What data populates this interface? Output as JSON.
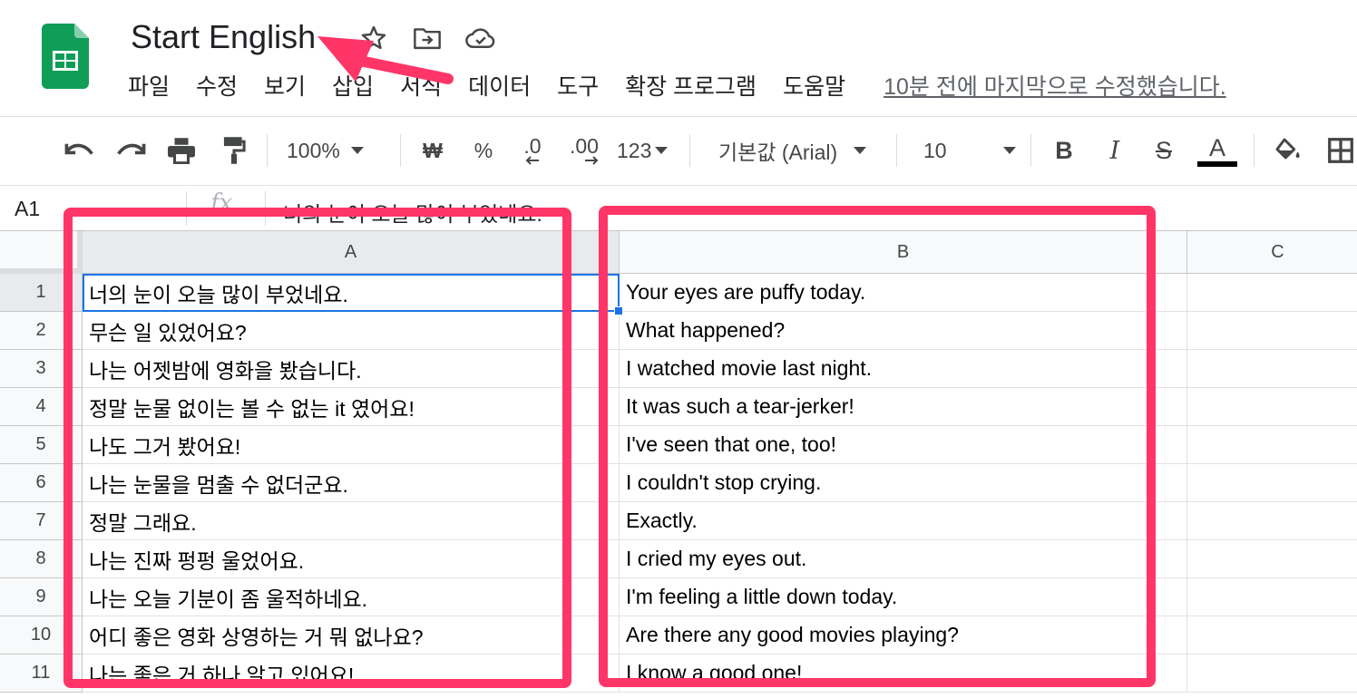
{
  "document": {
    "title": "Start English",
    "name_box": "A1",
    "formula_content": "너의 눈이 오늘 많이 부었네요.",
    "fx_icon": "fx"
  },
  "menu": {
    "items": [
      "파일",
      "수정",
      "보기",
      "삽입",
      "서식",
      "데이터",
      "도구",
      "확장 프로그램",
      "도움말"
    ],
    "last_edit": "10분 전에 마지막으로 수정했습니다."
  },
  "toolbar": {
    "zoom": "100%",
    "currency": "₩",
    "percent": "%",
    "decrease_decimal": ".0",
    "increase_decimal": ".00",
    "more_formats": "123",
    "font_family": "기본값 (Arial)",
    "font_size": "10",
    "bold": "B",
    "italic": "I",
    "strikethrough": "S",
    "text_color_glyph": "A",
    "text_color": "#000000"
  },
  "grid": {
    "columns": [
      "A",
      "B",
      "C"
    ],
    "selected_cell": "A1",
    "rows": [
      {
        "num": "1",
        "a": "너의 눈이 오늘 많이 부었네요.",
        "b": "Your eyes are puffy today."
      },
      {
        "num": "2",
        "a": "무슨 일 있었어요?",
        "b": "What happened?"
      },
      {
        "num": "3",
        "a": "나는 어젯밤에 영화을 봤습니다.",
        "b": "I watched movie last night."
      },
      {
        "num": "4",
        "a": "정말 눈물 없이는 볼 수 없는 it 였어요!",
        "b": "It was such a tear-jerker!"
      },
      {
        "num": "5",
        "a": "나도 그거 봤어요!",
        "b": "I've seen that one, too!"
      },
      {
        "num": "6",
        "a": "나는 눈물을 멈출 수 없더군요.",
        "b": "I couldn't stop crying."
      },
      {
        "num": "7",
        "a": "정말 그래요.",
        "b": "Exactly."
      },
      {
        "num": "8",
        "a": "나는 진짜 펑펑 울었어요.",
        "b": "I cried my eyes out."
      },
      {
        "num": "9",
        "a": "나는 오늘 기분이 좀 울적하네요.",
        "b": "I'm feeling a little down today."
      },
      {
        "num": "10",
        "a": "어디 좋은 영화 상영하는 거 뭐 없나요?",
        "b": "Are there any good movies playing?"
      },
      {
        "num": "11",
        "a": "나는 좋은 거 하나 알고 있어요!",
        "b": "I know a good one!"
      }
    ]
  },
  "colors": {
    "annotation": "#ff3568",
    "accent": "#1a73e8",
    "sheets_green": "#0f9d58"
  },
  "icons": [
    "sheets-logo-icon",
    "star-icon",
    "move-to-folder-icon",
    "cloud-saved-icon",
    "undo-icon",
    "redo-icon",
    "print-icon",
    "paint-format-icon",
    "fill-color-icon",
    "borders-icon"
  ]
}
